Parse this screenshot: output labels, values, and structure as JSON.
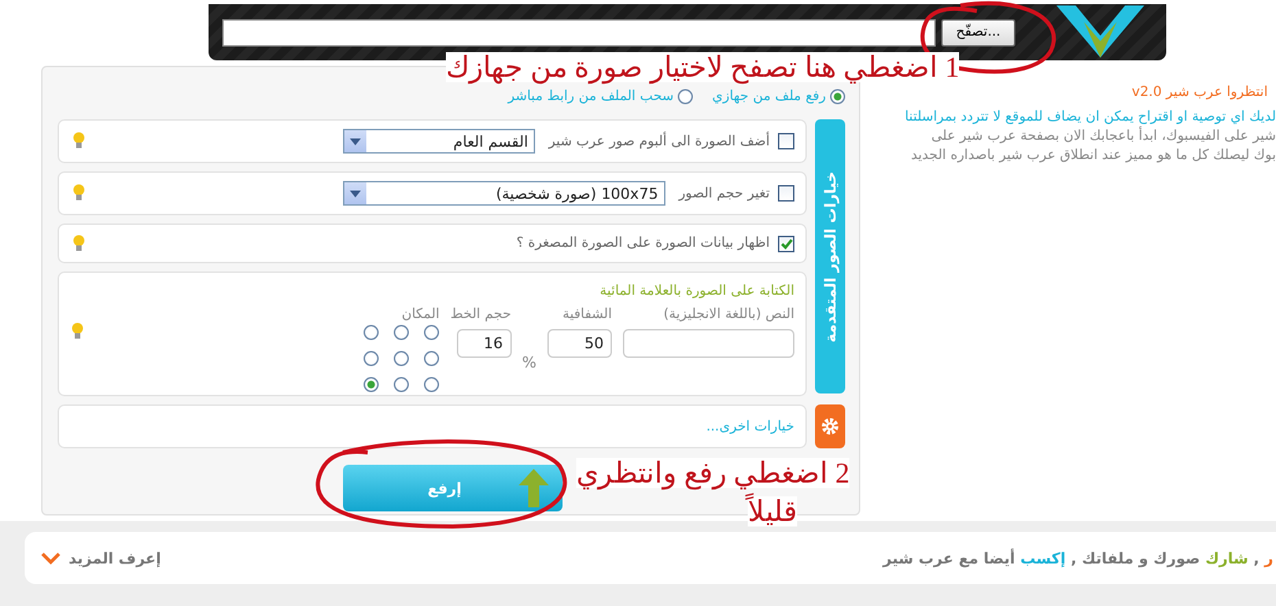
{
  "file_picker": {
    "browse_button": "تصفّح..."
  },
  "annotations": [
    {
      "text": "1 اضغطي هنا تصفح لاختيار صورة من جهازك"
    },
    {
      "text": "2 اضغطي رفع وانتظري"
    },
    {
      "text": "قليلاً"
    }
  ],
  "source_options": [
    {
      "label": "رفع ملف من جهازي",
      "selected": true
    },
    {
      "label": "سحب الملف من رابط مباشر",
      "selected": false
    }
  ],
  "advanced_tab": "خيارات الصور المتقدمة",
  "option_rows": [
    {
      "label": "أضف الصورة الى ألبوم صور عرب شير",
      "checked": false,
      "select": "القسم العام"
    },
    {
      "label": "تغير حجم الصور",
      "checked": false,
      "select": "100x75 (صورة شخصية)"
    },
    {
      "label": "اظهار بيانات الصورة على الصورة المصغرة ؟",
      "checked": true
    }
  ],
  "watermark": {
    "title": "الكتابة على الصورة بالعلامة المائية",
    "text_label": "النص (باللغة الانجليزية)",
    "opacity_label": "الشفافية",
    "opacity_value": "50",
    "percent": "%",
    "font_size_label": "حجم الخط",
    "font_size_value": "16",
    "position_label": "المكان",
    "positions": [
      {
        "selected": false
      },
      {
        "selected": false
      },
      {
        "selected": false
      },
      {
        "selected": false
      },
      {
        "selected": false
      },
      {
        "selected": false
      },
      {
        "selected": false
      },
      {
        "selected": false
      },
      {
        "selected": true
      }
    ]
  },
  "other_options": "خيارات اخرى...",
  "upload_button": "إرفع",
  "sidebar": {
    "title": "انتظروا عرب شير v2.0",
    "lines": [
      {
        "kind": "link",
        "text": "لديك اي توصية او اقتراح يمكن ان يضاف للموقع لا تتردد بمراسلتنا"
      },
      {
        "kind": "plain",
        "text": "شير على الفيسبوك، ابدأ باعجابك الان بصفحة عرب شير على"
      },
      {
        "kind": "plain",
        "text": "بوك ليصلك كل ما هو مميز عند انطلاق عرب شير باصداره الجديد"
      }
    ]
  },
  "footer": {
    "segments": [
      {
        "text": "ر",
        "color": "#f26d21"
      },
      {
        "text": " , ",
        "color": "#777777"
      },
      {
        "text": "شارك",
        "color": "#8cb12c"
      },
      {
        "text": " صورك و ملفاتك , ",
        "color": "#777777"
      },
      {
        "text": "إكسب",
        "color": "#1ab3d8"
      },
      {
        "text": " أيضا مع عرب شير",
        "color": "#777777"
      }
    ],
    "more": "إعرف المزيد"
  }
}
